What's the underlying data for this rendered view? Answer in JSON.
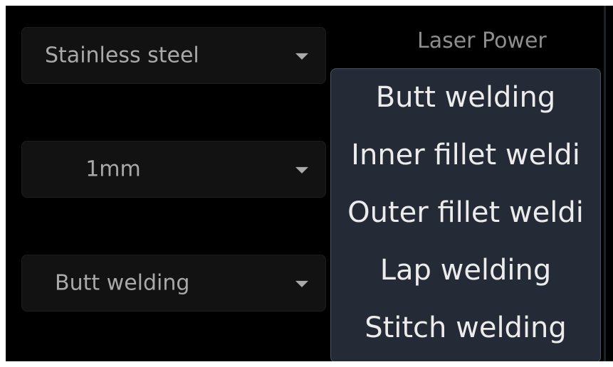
{
  "form": {
    "material": {
      "value": "Stainless steel"
    },
    "thickness": {
      "value": "1mm"
    },
    "weld_type": {
      "value": "Butt welding"
    }
  },
  "labels": {
    "laser_power": "Laser Power"
  },
  "weld_dropdown": {
    "options": [
      "Butt welding",
      "Inner fillet weldi",
      "Outer fillet weldi",
      "Lap welding",
      "Stitch welding"
    ]
  },
  "colors": {
    "background": "#000000",
    "select_bg": "#121212",
    "select_text": "#a9a9a9",
    "dropdown_bg": "#242b37",
    "dropdown_border": "#495262",
    "dropdown_text": "#ececec"
  }
}
